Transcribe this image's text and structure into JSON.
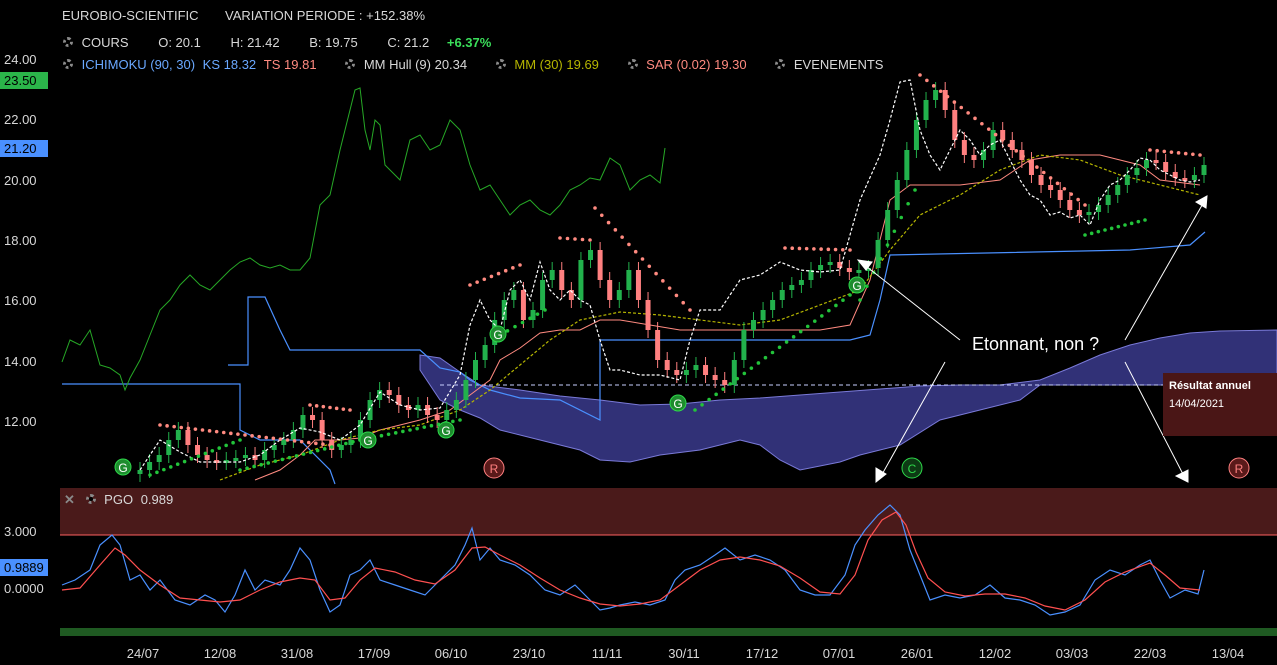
{
  "header": {
    "name": "EUROBIO-SCIENTIFIC",
    "variation": "VARIATION PERIODE : +152.38%"
  },
  "quote": {
    "label": "COURS",
    "open": "O: 20.1",
    "high": "H: 21.42",
    "low": "B: 19.75",
    "close": "C: 21.2",
    "change": "+6.37%"
  },
  "indicators": {
    "ichimoku": "ICHIMOKU (90, 30)",
    "ks": "KS 18.32",
    "ts": "TS 19.81",
    "hull": "MM Hull (9) 20.34",
    "mm": "MM (30) 19.69",
    "sar": "SAR (0.02) 19.30",
    "events": "EVENEMENTS"
  },
  "price_axis": {
    "ticks": [
      "24.00",
      "22.00",
      "20.00",
      "18.00",
      "16.00",
      "14.00",
      "12.00"
    ],
    "badge_green": "23.50",
    "badge_blue": "21.20"
  },
  "oscillator": {
    "label": "PGO",
    "value": "0.989",
    "ticks": [
      "3.000",
      "0.0000"
    ],
    "badge": "0.9889"
  },
  "x_axis": [
    "24/07",
    "12/08",
    "31/08",
    "17/09",
    "06/10",
    "23/10",
    "11/11",
    "30/11",
    "17/12",
    "07/01",
    "26/01",
    "12/02",
    "03/03",
    "22/03",
    "13/04"
  ],
  "annotation": {
    "text": "Etonnant, non ?"
  },
  "event_box": {
    "title": "Résultat annuel",
    "date": "14/04/2021"
  },
  "markers": {
    "g": "G",
    "r": "R",
    "c": "C"
  },
  "colors": {
    "up": "#22b14c",
    "down": "#ff8080",
    "cloud": "#3a3a8c",
    "kijun": "#4a90ff",
    "tenkan": "#ff8a80",
    "hull": "#ffffff",
    "mm30": "#b5b500",
    "sar_up": "#22c33a",
    "sar_down": "#ff8a80",
    "chikou": "#26a826",
    "pgo_fast": "#4a90ff",
    "pgo_slow": "#ff5050",
    "overbought_band": "#4a1a1a"
  },
  "chart_data": {
    "type": "line",
    "x": [
      "24/07",
      "12/08",
      "31/08",
      "17/09",
      "06/10",
      "23/10",
      "11/11",
      "30/11",
      "17/12",
      "07/01",
      "26/01",
      "12/02",
      "03/03",
      "22/03",
      "13/04"
    ],
    "series": [
      {
        "values": [
          10.9,
          11.5,
          11.6,
          12.3,
          12.4,
          16.0,
          14.5,
          14.6,
          17.0,
          17.2,
          21.0,
          19.2,
          19.5,
          20.5,
          21.2
        ]
      },
      {
        "values": [
          12.3,
          12.4,
          12.5,
          13.5,
          14.5,
          14.6,
          14.5,
          15.0,
          15.0,
          15.5,
          16.2,
          16.5,
          16.7,
          17.0,
          17.4
        ]
      }
    ],
    "yticks": [
      24,
      22,
      20,
      18,
      16,
      14,
      12
    ],
    "ylim": [
      10,
      25
    ]
  }
}
